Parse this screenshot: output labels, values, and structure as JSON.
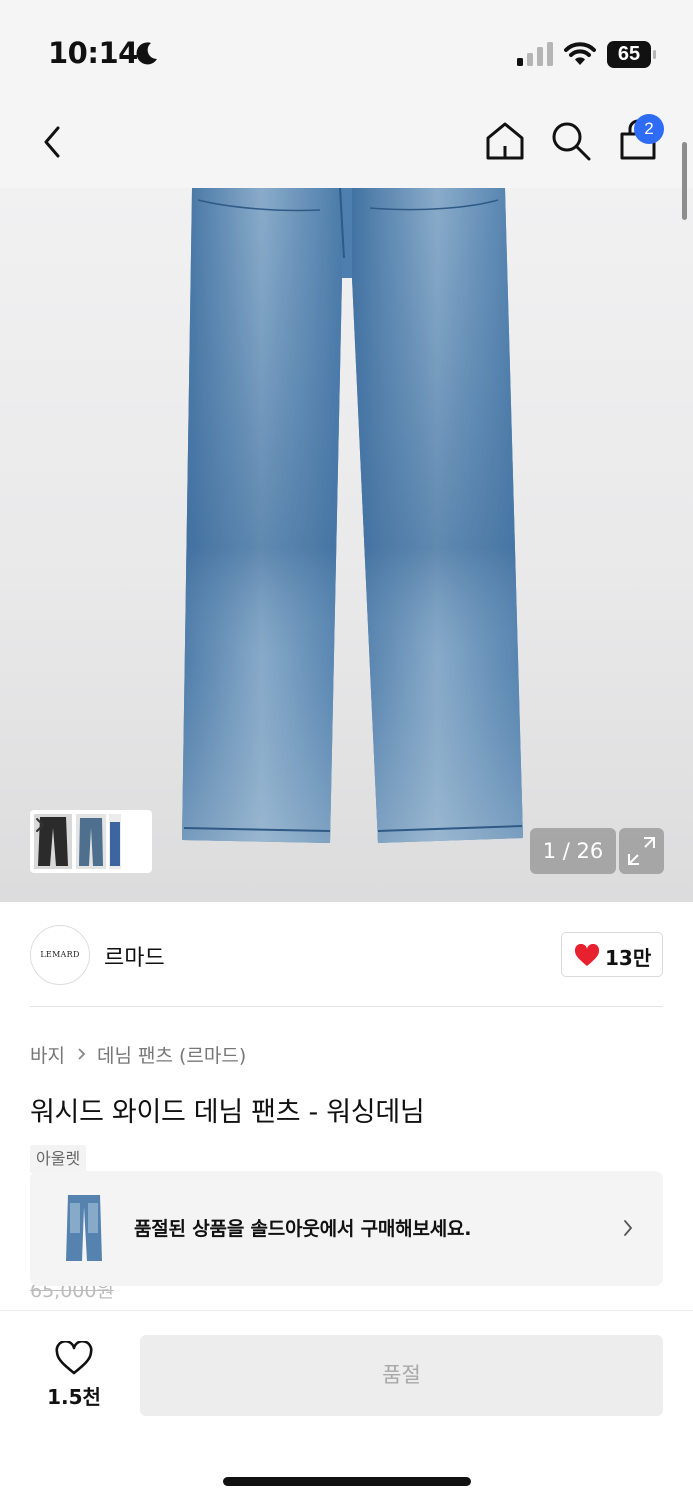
{
  "status_bar": {
    "time": "10:14",
    "battery": "65",
    "icons": [
      "moon-icon",
      "signal-icon",
      "wifi-icon",
      "battery-icon"
    ]
  },
  "nav": {
    "icons": [
      "back-icon",
      "home-icon",
      "search-icon",
      "shopping-bag-icon"
    ],
    "cart_count": "2"
  },
  "gallery": {
    "counter": "1 / 26",
    "current_index": 1,
    "total": 26
  },
  "brand": {
    "logo_text": "LEMARD",
    "name": "르마드",
    "likes": "13만"
  },
  "breadcrumb": {
    "category": "바지",
    "subcategory": "데님 팬츠 (르마드)"
  },
  "product": {
    "title": "워시드 와이드 데님 팬츠 - 워싱데님",
    "outlet_tag": "아울렛",
    "price_partial": "65,000원"
  },
  "soldout_banner": {
    "text": "품절된 상품을 솔드아웃에서 구매해보세요."
  },
  "bottom_bar": {
    "wish_count": "1.5천",
    "buy_button": "품절"
  },
  "colors": {
    "accent_blue": "#2f6cf5",
    "heart_red": "#e8212f",
    "denim": "#4f7fae"
  }
}
